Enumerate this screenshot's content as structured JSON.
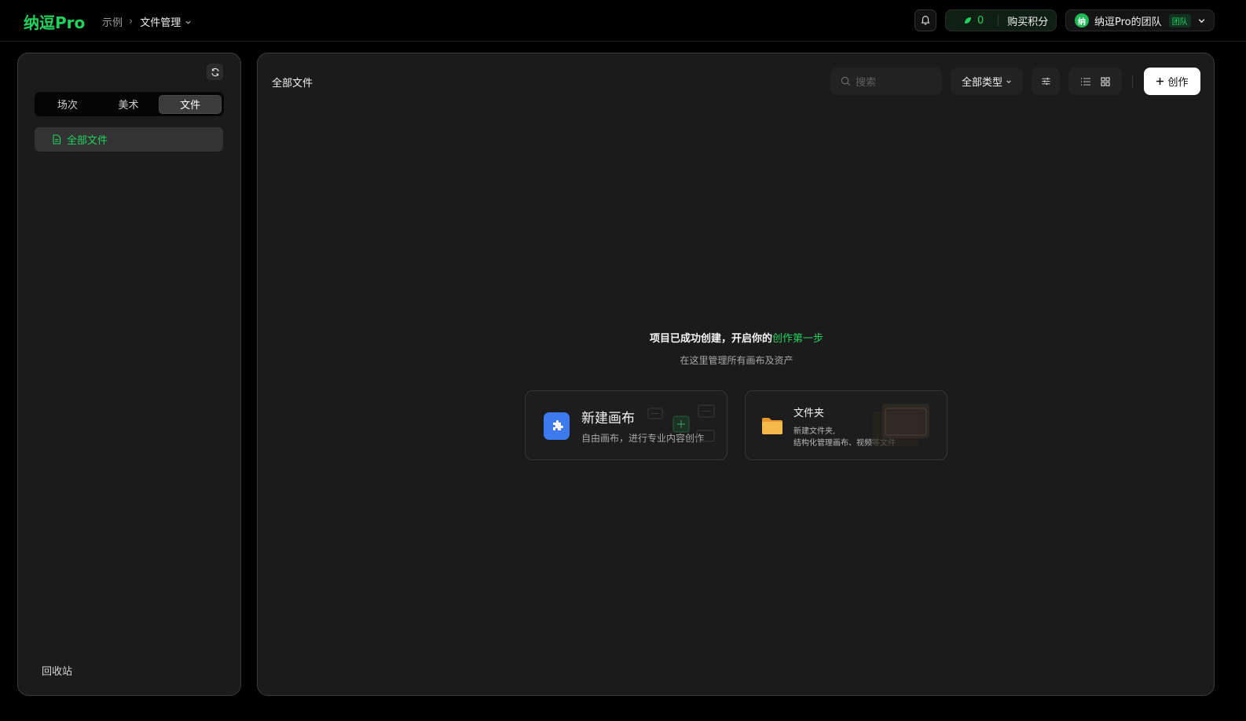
{
  "brand": {
    "logo": "纳逗Pro"
  },
  "breadcrumb": {
    "root": "示例",
    "current": "文件管理"
  },
  "header": {
    "points_count": "0",
    "buy_points": "购买积分",
    "team_avatar": "纳",
    "team_name": "纳逗Pro的团队",
    "team_tag": "团队"
  },
  "sidebar": {
    "tabs": [
      {
        "label": "场次",
        "active": false
      },
      {
        "label": "美术",
        "active": false
      },
      {
        "label": "文件",
        "active": true
      }
    ],
    "items": [
      {
        "label": "全部文件",
        "icon": "file-icon",
        "active": true
      }
    ],
    "trash": "回收站"
  },
  "main": {
    "title": "全部文件",
    "search_placeholder": "搜索",
    "type_filter": "全部类型",
    "create_label": "创作",
    "empty": {
      "title_prefix": "项目已成功创建，开启你的",
      "title_highlight": "创作第一步",
      "subtitle": "在这里管理所有画布及资产"
    },
    "cards": [
      {
        "title": "新建画布",
        "desc": "自由画布，进行专业内容创作",
        "icon": "canvas-icon"
      },
      {
        "title": "文件夹",
        "desc_line1": "新建文件夹,",
        "desc_line2": "结构化管理画布、视频等文件",
        "icon": "folder-icon"
      }
    ]
  },
  "colors": {
    "accent": "#1fd35c",
    "card_icon_blue": "#3d7af0",
    "folder": "#f5a623"
  }
}
